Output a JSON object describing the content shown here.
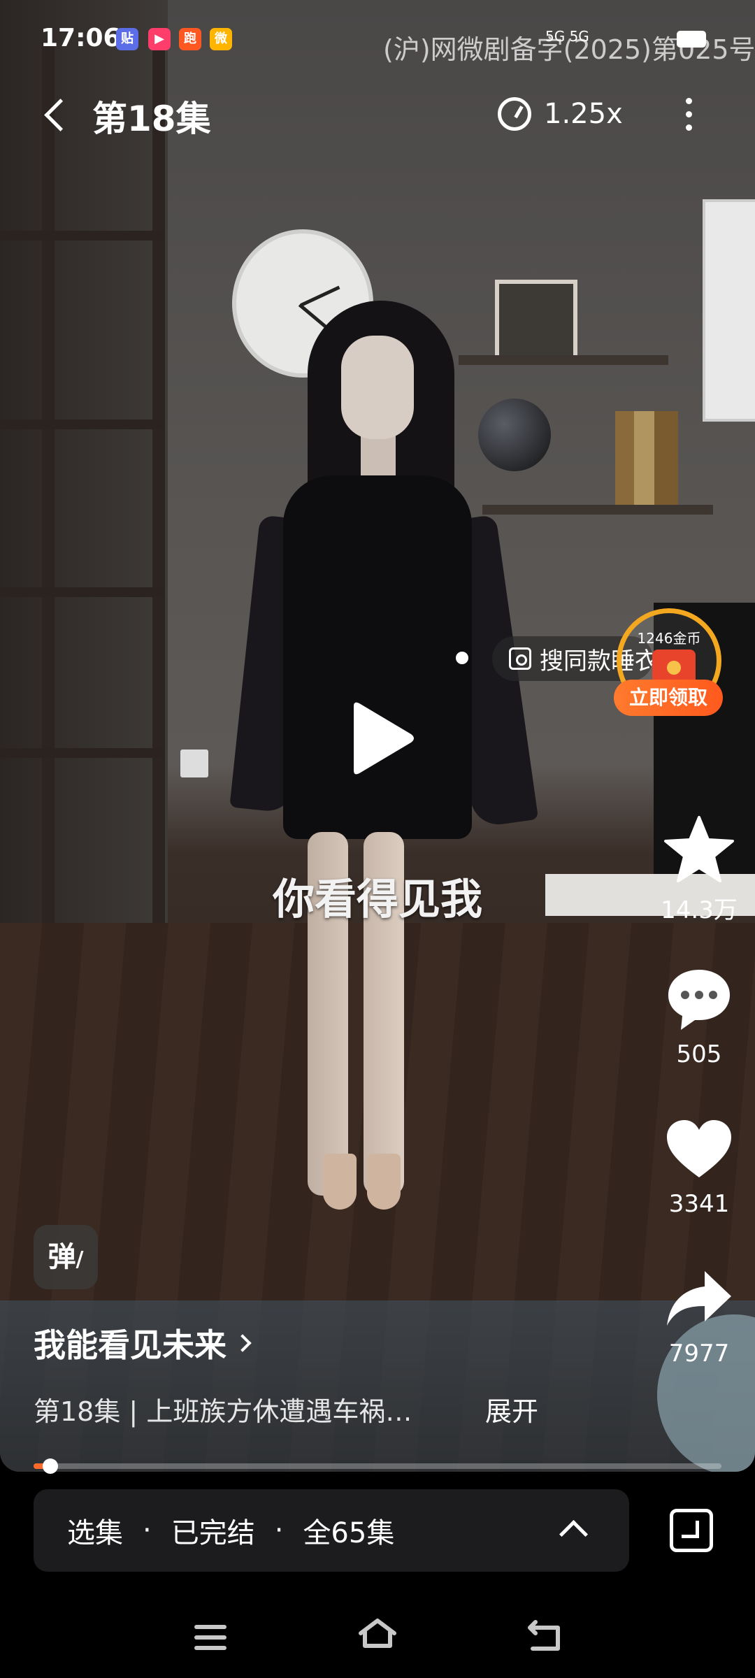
{
  "status_bar": {
    "time": "17:06",
    "app_icons": [
      {
        "name": "app-icon-1",
        "text": "贴",
        "color": "#5b6ee8"
      },
      {
        "name": "app-icon-2",
        "text": "▶",
        "color": "#ff3d6b"
      },
      {
        "name": "app-icon-3",
        "text": "跑",
        "color": "#ff5722"
      },
      {
        "name": "app-icon-4",
        "text": "微",
        "color": "#ffb400"
      }
    ],
    "license": "(沪)网微剧备字(2025)第025号",
    "signal": "5G 5G"
  },
  "top_bar": {
    "episode_title": "第18集",
    "speed_label": "1.25x"
  },
  "video": {
    "subtitle": "你看得见我"
  },
  "search_pill": {
    "label": "搜同款睡衣"
  },
  "coin_widget": {
    "amount": "1246金币",
    "button": "立即领取"
  },
  "actions": {
    "favorite_count": "14.3万",
    "comment_count": "505",
    "like_count": "3341",
    "share_count": "7977"
  },
  "danmaku": {
    "label": "弹"
  },
  "series": {
    "title": "我能看见未来",
    "description": "第18集 | 上班族方休遭遇车祸…",
    "expand_label": "展开"
  },
  "progress": {
    "value": 0.024
  },
  "episode_bar": {
    "select_label": "选集",
    "sep": "·",
    "status_label": "已完结",
    "total_label": "全65集"
  },
  "colors": {
    "accent": "#ff6a2a",
    "coin_ring": "#f4a81f"
  }
}
